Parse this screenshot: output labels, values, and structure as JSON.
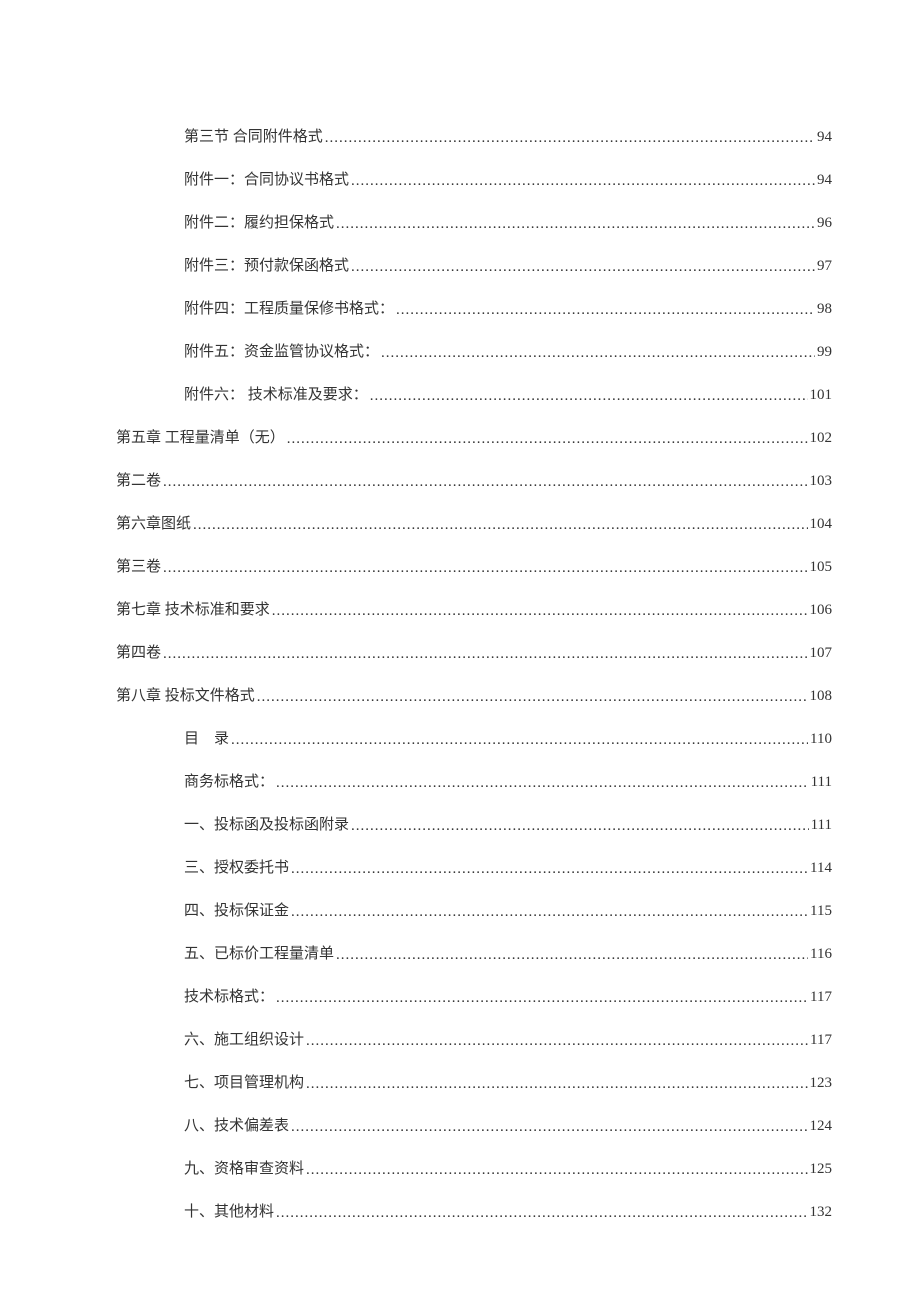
{
  "toc": [
    {
      "level": 1,
      "label": "第三节 合同附件格式",
      "page": "94"
    },
    {
      "level": 1,
      "label": "附件一：合同协议书格式",
      "page": "94"
    },
    {
      "level": 1,
      "label": "附件二：履约担保格式",
      "page": "96"
    },
    {
      "level": 1,
      "label": "附件三：预付款保函格式",
      "page": "97"
    },
    {
      "level": 1,
      "label": "附件四：工程质量保修书格式：",
      "page": "98"
    },
    {
      "level": 1,
      "label": "附件五：资金监管协议格式：",
      "page": "99"
    },
    {
      "level": 1,
      "label": "附件六： 技术标准及要求：",
      "page": "101"
    },
    {
      "level": 0,
      "label": "第五章 工程量清单（无）",
      "page": "102"
    },
    {
      "level": 0,
      "label": "第二卷",
      "page": "103"
    },
    {
      "level": 0,
      "label": "第六章图纸",
      "page": "104"
    },
    {
      "level": 0,
      "label": "第三卷",
      "page": "105"
    },
    {
      "level": 0,
      "label": "第七章 技术标准和要求",
      "page": "106"
    },
    {
      "level": 0,
      "label": "第四卷",
      "page": "107"
    },
    {
      "level": 0,
      "label": "第八章 投标文件格式",
      "page": "108"
    },
    {
      "level": 1,
      "label": "目　录",
      "page": "110"
    },
    {
      "level": 1,
      "label": "商务标格式：",
      "page": "111"
    },
    {
      "level": 1,
      "label": "一、投标函及投标函附录",
      "page": "111"
    },
    {
      "level": 1,
      "label": "三、授权委托书",
      "page": "114"
    },
    {
      "level": 1,
      "label": "四、投标保证金",
      "page": "115"
    },
    {
      "level": 1,
      "label": "五、已标价工程量清单",
      "page": "116"
    },
    {
      "level": 1,
      "label": "技术标格式：",
      "page": "117"
    },
    {
      "level": 1,
      "label": "六、施工组织设计",
      "page": "117"
    },
    {
      "level": 1,
      "label": "七、项目管理机构",
      "page": "123"
    },
    {
      "level": 1,
      "label": "八、技术偏差表",
      "page": "124"
    },
    {
      "level": 1,
      "label": "九、资格审查资料",
      "page": "125"
    },
    {
      "level": 1,
      "label": "十、其他材料",
      "page": "132"
    }
  ]
}
